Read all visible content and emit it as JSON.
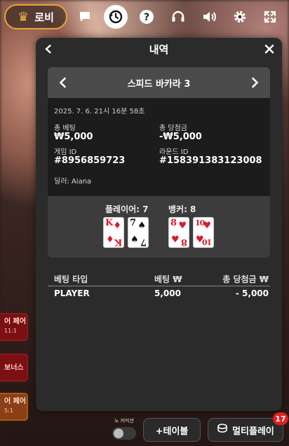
{
  "topbar": {
    "lobby_label": "로비"
  },
  "modal": {
    "title": "내역",
    "game": {
      "title": "스피드 바카라 3",
      "datetime": "2025. 7. 6. 21시 16분 58초",
      "total_bet_label": "총 베팅",
      "total_bet_value": "₩5,000",
      "total_win_label": "총 당첨금",
      "total_win_value": "-₩5,000",
      "game_id_label": "게임 ID",
      "game_id_value": "#8956859723",
      "round_id_label": "라운드 ID",
      "round_id_value": "#158391383123008",
      "dealer": "딜러: Aiana"
    },
    "result": {
      "player_label": "플레이어: 7",
      "banker_label": "뱅커: 8",
      "player_cards": [
        {
          "rank": "K",
          "suit": "♦",
          "color": "red"
        },
        {
          "rank": "7",
          "suit": "♠",
          "color": "black"
        }
      ],
      "banker_cards": [
        {
          "rank": "8",
          "suit": "♥",
          "color": "red"
        },
        {
          "rank": "10",
          "suit": "♥",
          "color": "red"
        }
      ]
    },
    "table": {
      "headers": [
        "베팅 타입",
        "베팅 ₩",
        "총 당첨금 ₩"
      ],
      "rows": [
        [
          "PLAYER",
          "5,000",
          "- 5,000"
        ]
      ]
    }
  },
  "side_bets": [
    {
      "label": "어 페어",
      "sub": "11:1"
    },
    {
      "label": "보너스",
      "sub": ""
    },
    {
      "label": "어 페어",
      "sub": "5:1"
    }
  ],
  "bottom": {
    "no_commission_label": "노 커미션",
    "add_table_label": "+테이블",
    "multiplay_label": "멀티플레이",
    "multiplay_badge": "17"
  },
  "icons": {
    "lobby": "crown-icon",
    "chat": "chat-icon",
    "history": "history-icon",
    "help": "help-icon",
    "headset": "headset-icon",
    "volume": "volume-icon",
    "settings": "gear-icon",
    "fullscreen": "fullscreen-icon"
  },
  "colors": {
    "lobby_border": "#e3a63a",
    "card_red": "#d81b2b",
    "badge": "#e02020"
  }
}
